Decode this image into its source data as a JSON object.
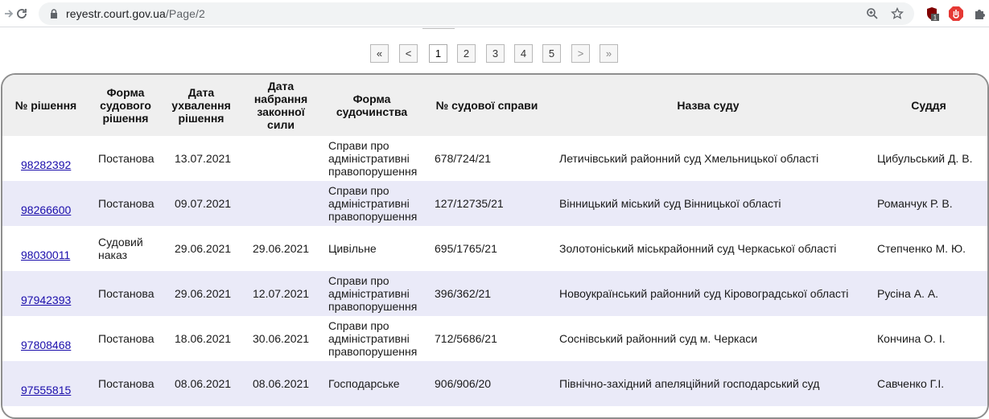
{
  "browser": {
    "url_host": "reyestr.court.gov.ua",
    "url_path": "/Page/2",
    "ext_badge": "1"
  },
  "pager": {
    "first": "«",
    "prev": "<",
    "pages": [
      "1",
      "2",
      "3",
      "4",
      "5"
    ],
    "current": "1",
    "next": ">",
    "last": "»"
  },
  "table": {
    "headers": {
      "number": "№ рішення",
      "form": "Форма судового рішення",
      "date_adopted": "Дата ухвалення рішення",
      "date_effective": "Дата набрання законної сили",
      "proceeding": "Форма судочинства",
      "case_no": "№ судової справи",
      "court": "Назва суду",
      "judge": "Суддя"
    },
    "rows": [
      {
        "number": "98282392",
        "form": "Постанова",
        "date_adopted": "13.07.2021",
        "date_effective": "",
        "proceeding": "Справи про адміністративні правопорушення",
        "case_no": "678/724/21",
        "court": "Летичівський районний суд Хмельницької області",
        "judge": "Цибульський Д. В."
      },
      {
        "number": "98266600",
        "form": "Постанова",
        "date_adopted": "09.07.2021",
        "date_effective": "",
        "proceeding": "Справи про адміністративні правопорушення",
        "case_no": "127/12735/21",
        "court": "Вінницький міський суд Вінницької області",
        "judge": "Романчук Р. В."
      },
      {
        "number": "98030011",
        "form": "Судовий наказ",
        "date_adopted": "29.06.2021",
        "date_effective": "29.06.2021",
        "proceeding": "Цивільне",
        "case_no": "695/1765/21",
        "court": "Золотоніський міськрайонний суд Черкаської області",
        "judge": "Степченко М. Ю."
      },
      {
        "number": "97942393",
        "form": "Постанова",
        "date_adopted": "29.06.2021",
        "date_effective": "12.07.2021",
        "proceeding": "Справи про адміністративні правопорушення",
        "case_no": "396/362/21",
        "court": "Новоукраїнський районний суд Кіровоградської області",
        "judge": "Русіна А. А."
      },
      {
        "number": "97808468",
        "form": "Постанова",
        "date_adopted": "18.06.2021",
        "date_effective": "30.06.2021",
        "proceeding": "Справи про адміністративні правопорушення",
        "case_no": "712/5686/21",
        "court": "Соснівський районний суд м. Черкаси",
        "judge": "Кончина О. І."
      },
      {
        "number": "97555815",
        "form": "Постанова",
        "date_adopted": "08.06.2021",
        "date_effective": "08.06.2021",
        "proceeding": "Господарське",
        "case_no": "906/906/20",
        "court": "Північно-західний апеляційний господарський суд",
        "judge": "Савченко Г.І."
      }
    ]
  },
  "colors": {
    "row_alt": "#eaeaf8",
    "header_bg": "#efefef",
    "link": "#1a0dab"
  }
}
